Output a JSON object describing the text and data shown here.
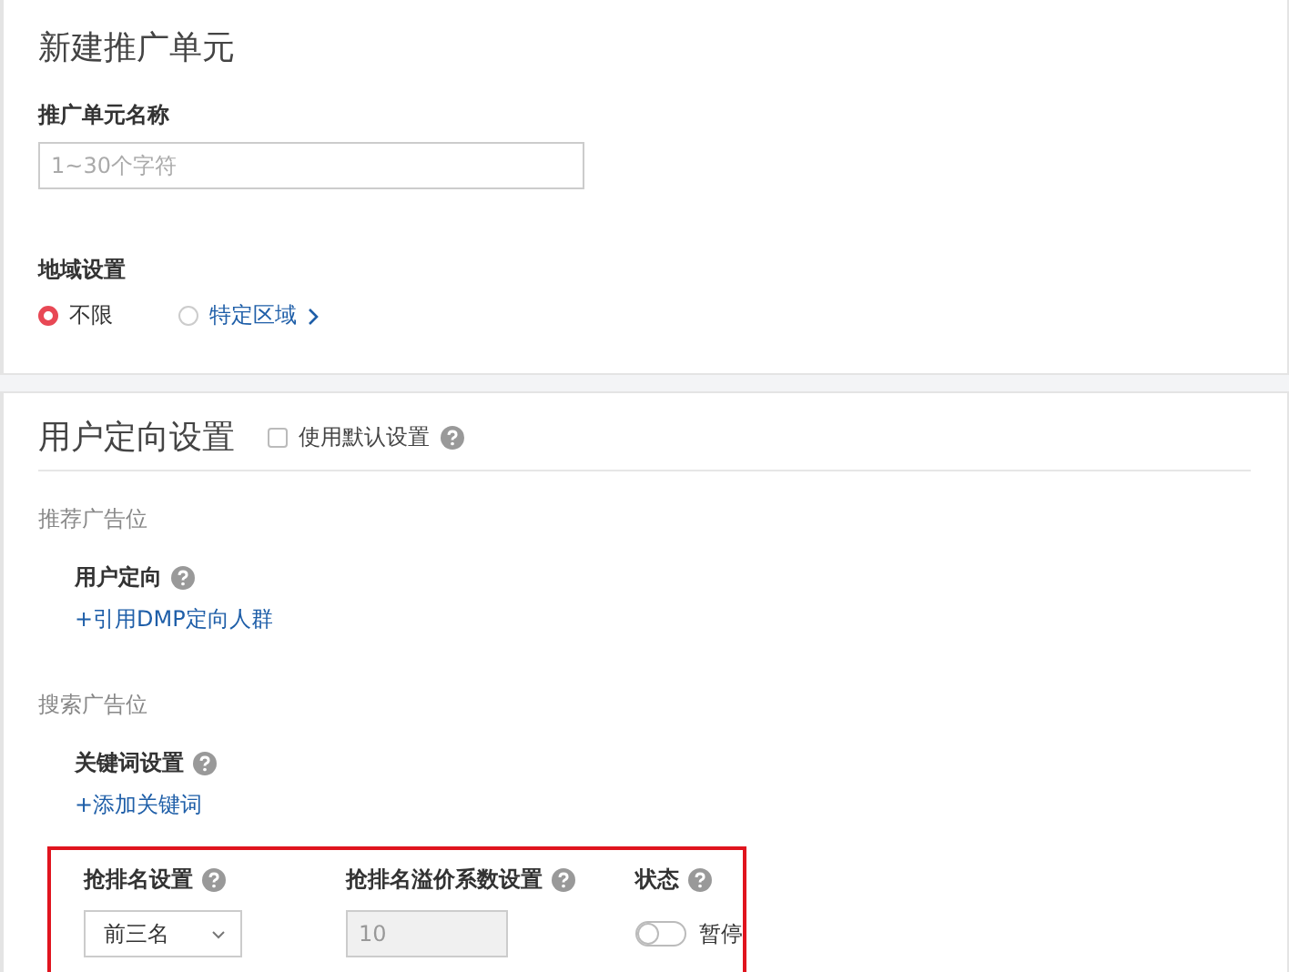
{
  "unit_panel": {
    "title": "新建推广单元",
    "name_field": {
      "label": "推广单元名称",
      "placeholder": "1~30个字符"
    },
    "region": {
      "label": "地域设置",
      "options": [
        {
          "label": "不限",
          "selected": true,
          "has_chevron": false
        },
        {
          "label": "特定区域",
          "selected": false,
          "has_chevron": true
        }
      ]
    }
  },
  "targeting_panel": {
    "title": "用户定向设置",
    "default_checkbox": {
      "label": "使用默认设置",
      "checked": false
    },
    "groups": [
      {
        "heading": "推荐广告位",
        "field_label": "用户定向",
        "link": "+引用DMP定向人群"
      },
      {
        "heading": "搜索广告位",
        "field_label": "关键词设置",
        "link": "+添加关键词"
      }
    ],
    "bidding": {
      "highlighted": true,
      "columns": [
        {
          "kind": "select",
          "label": "抢排名设置",
          "value": "前三名"
        },
        {
          "kind": "input",
          "label": "抢排名溢价系数设置",
          "value": "10",
          "disabled": true
        },
        {
          "kind": "toggle",
          "label": "状态",
          "on": false,
          "text": "暂停"
        }
      ]
    }
  }
}
